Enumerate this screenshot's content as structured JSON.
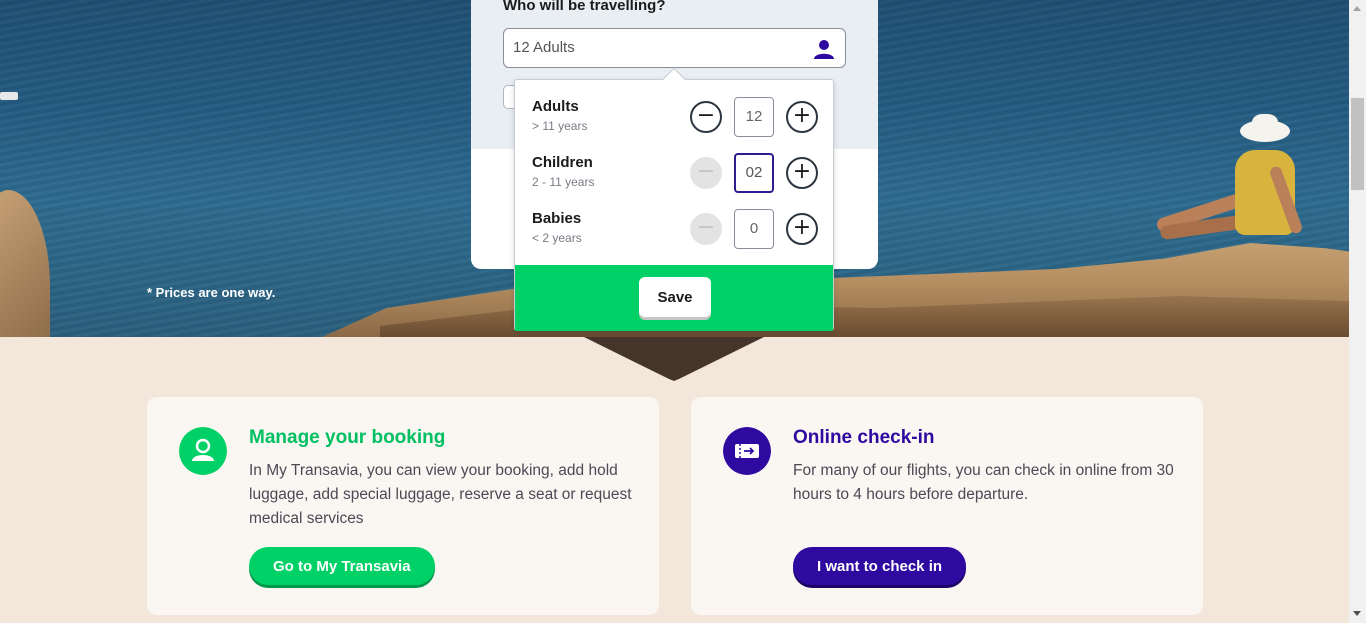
{
  "hero": {
    "prices_note": "* Prices are one way."
  },
  "booking": {
    "travel_label": "Who will be travelling?",
    "travel_value": "12 Adults",
    "passengers": [
      {
        "name": "Adults",
        "age": "> 11 years",
        "count": "12",
        "minus_enabled": true
      },
      {
        "name": "Children",
        "age": "2 - 11 years",
        "count": "02",
        "minus_enabled": false
      },
      {
        "name": "Babies",
        "age": "< 2 years",
        "count": "0",
        "minus_enabled": false
      }
    ],
    "minus_symbol": "−",
    "plus_symbol": "+",
    "save_label": "Save"
  },
  "cards": {
    "manage": {
      "title": "Manage your booking",
      "text": "In My Transavia, you can view your booking, add hold luggage, add special luggage, reserve a seat or request medical services",
      "button": "Go to My Transavia",
      "icon": "user-icon"
    },
    "checkin": {
      "title": "Online check-in",
      "text": "For many of our flights, you can check in online from 30 hours to 4 hours before departure.",
      "button": "I want to check in",
      "icon": "boarding-pass-icon"
    }
  },
  "colors": {
    "green": "#00d167",
    "purple": "#2f0aa0",
    "card_bg": "#faf6f2",
    "page_bg": "#f3e6db"
  }
}
